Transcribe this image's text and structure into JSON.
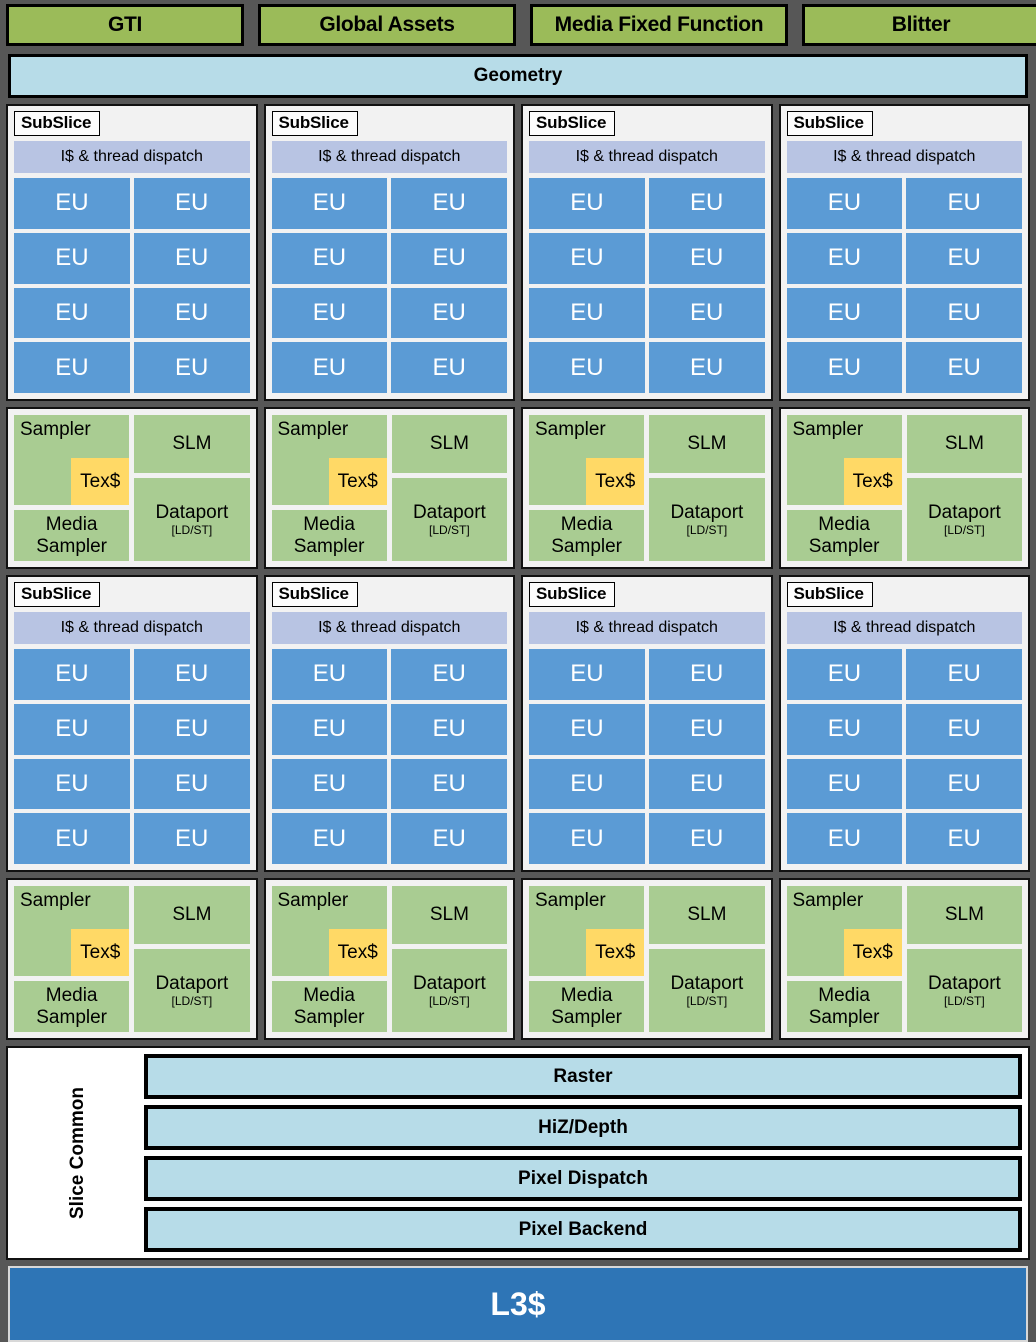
{
  "top_blocks": [
    {
      "label": "GTI"
    },
    {
      "label": "Global Assets"
    },
    {
      "label": "Media Fixed Function"
    },
    {
      "label": "Blitter"
    }
  ],
  "geometry": {
    "label": "Geometry"
  },
  "subslice": {
    "title": "SubSlice",
    "thread_dispatch": "I$ & thread dispatch",
    "eu_label": "EU",
    "eu_count": 8
  },
  "sampler_group": {
    "sampler": "Sampler",
    "tex_cache": "Tex$",
    "media_sampler": "Media\nSampler",
    "media_sampler_l1": "Media",
    "media_sampler_l2": "Sampler",
    "slm": "SLM",
    "dataport": "Dataport",
    "dataport_sub": "[LD/ST]"
  },
  "slice_common": {
    "label": "Slice Common",
    "bars": [
      {
        "label": "Raster"
      },
      {
        "label": "HiZ/Depth"
      },
      {
        "label": "Pixel Dispatch"
      },
      {
        "label": "Pixel Backend"
      }
    ]
  },
  "l3_cache": {
    "label": "L3$"
  },
  "colors": {
    "background": "#575757",
    "header_green": "#9BBB59",
    "eu_blue": "#5B9BD5",
    "light_blue": "#B7DCE8",
    "lavender": "#B8C4E3",
    "sampler_green": "#A9CC92",
    "tex_yellow": "#FFD966",
    "l3_blue": "#2E75B6",
    "subslice_bg": "#F2F2F2"
  },
  "counts": {
    "subslice_rows": 2,
    "subslice_cols": 4
  }
}
